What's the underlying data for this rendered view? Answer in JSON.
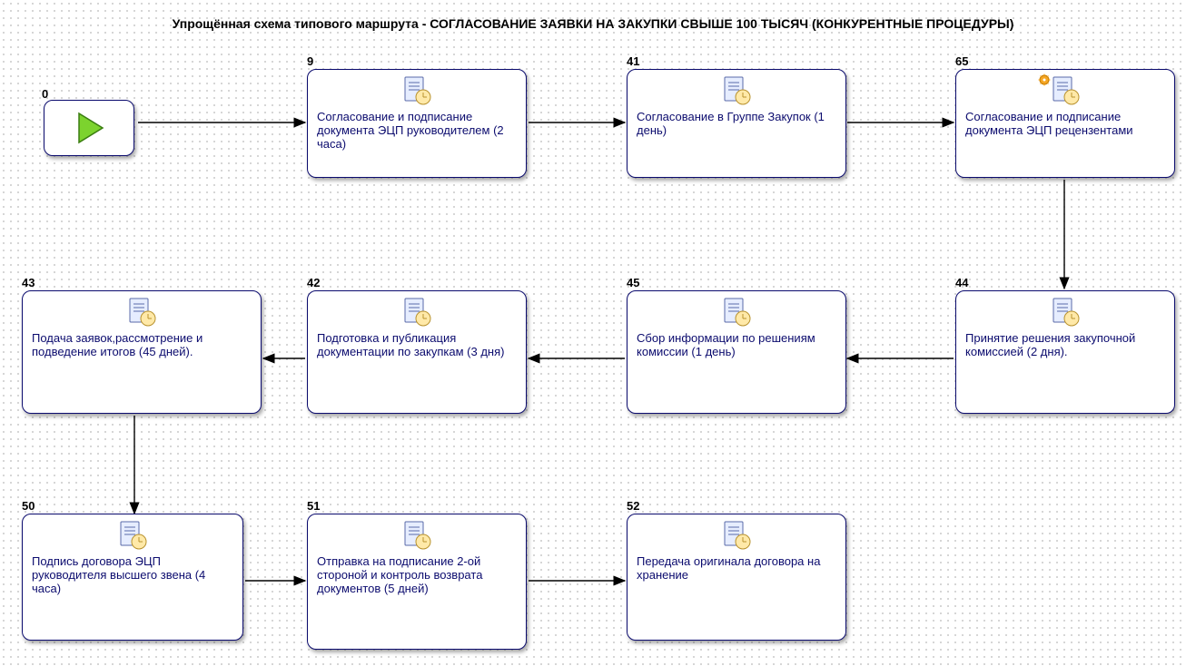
{
  "title": "Упрощённая схема типового маршрута - СОГЛАСОВАНИЕ ЗАЯВКИ НА ЗАКУПКИ СВЫШЕ 100 ТЫСЯЧ (КОНКУРЕНТНЫЕ ПРОЦЕДУРЫ)",
  "nodes": {
    "start": {
      "id": "0"
    },
    "n9": {
      "id": "9",
      "text": "Согласование и подписание документа ЭЦП руководителем (2 часа)"
    },
    "n41": {
      "id": "41",
      "text": "Согласование в Группе Закупок (1 день)"
    },
    "n65": {
      "id": "65",
      "text": "Согласование и подписание документа ЭЦП рецензентами"
    },
    "n44": {
      "id": "44",
      "text": "Принятие решения закупочной комиссией (2 дня)."
    },
    "n45": {
      "id": "45",
      "text": "Сбор информации по решениям комиссии (1 день)"
    },
    "n42": {
      "id": "42",
      "text": "Подготовка и публикация документации по закупкам (3 дня)"
    },
    "n43": {
      "id": "43",
      "text": "Подача заявок,рассмотрение и подведение итогов (45 дней)."
    },
    "n50": {
      "id": "50",
      "text": "Подпись договора ЭЦП руководителя высшего звена (4 часа)"
    },
    "n51": {
      "id": "51",
      "text": "Отправка на подписание 2-ой стороной и контроль возврата документов (5 дней)"
    },
    "n52": {
      "id": "52",
      "text": "Передача оригинала договора на хранение"
    }
  }
}
